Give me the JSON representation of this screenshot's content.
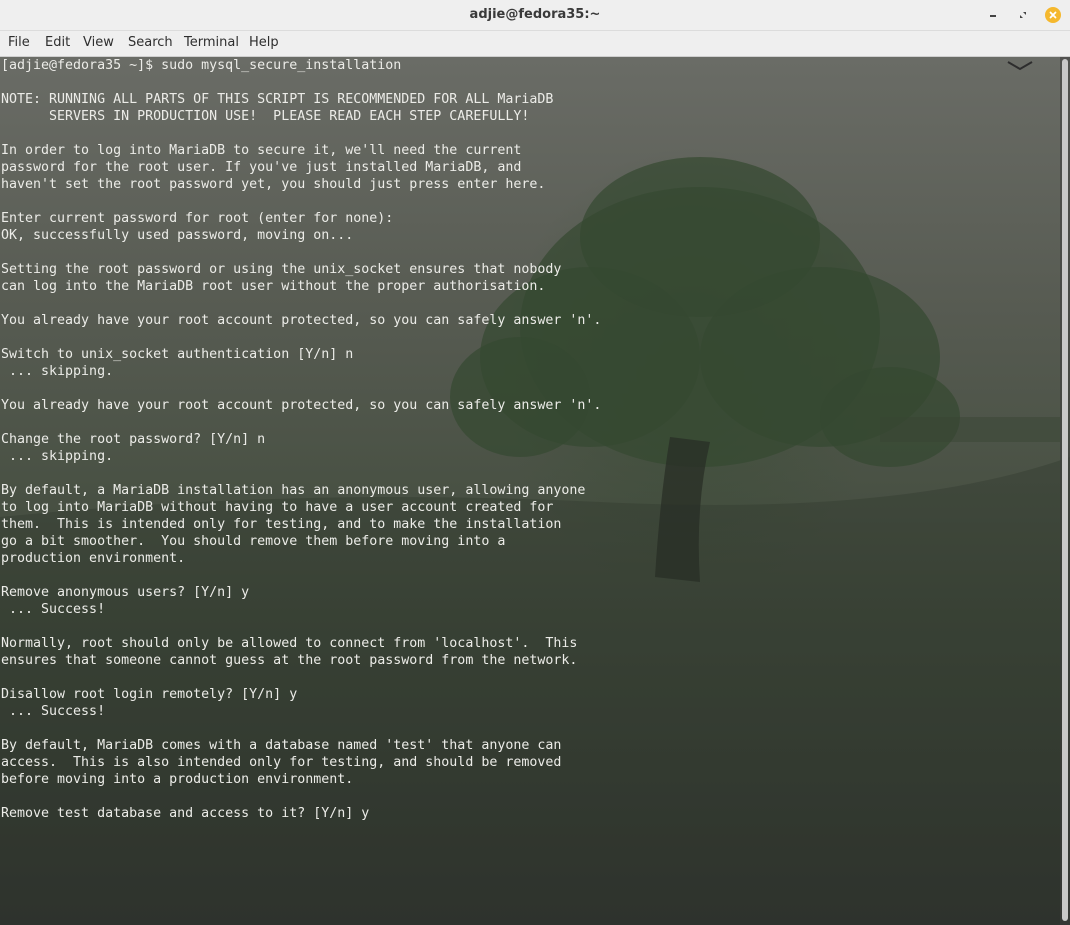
{
  "window": {
    "title": "adjie@fedora35:~"
  },
  "menu": [
    "File",
    "Edit",
    "View",
    "Search",
    "Terminal",
    "Help"
  ],
  "icons": {
    "minimize": "minimize-icon",
    "maximize": "maximize-icon",
    "close": "close-icon"
  },
  "colors": {
    "close_button": "#f5b82e",
    "terminal_text": "#ecece8",
    "titlebar": "#efefef"
  },
  "terminal": {
    "lines": [
      "[adjie@fedora35 ~]$ sudo mysql_secure_installation",
      "",
      "NOTE: RUNNING ALL PARTS OF THIS SCRIPT IS RECOMMENDED FOR ALL MariaDB",
      "      SERVERS IN PRODUCTION USE!  PLEASE READ EACH STEP CAREFULLY!",
      "",
      "In order to log into MariaDB to secure it, we'll need the current",
      "password for the root user. If you've just installed MariaDB, and",
      "haven't set the root password yet, you should just press enter here.",
      "",
      "Enter current password for root (enter for none):",
      "OK, successfully used password, moving on...",
      "",
      "Setting the root password or using the unix_socket ensures that nobody",
      "can log into the MariaDB root user without the proper authorisation.",
      "",
      "You already have your root account protected, so you can safely answer 'n'.",
      "",
      "Switch to unix_socket authentication [Y/n] n",
      " ... skipping.",
      "",
      "You already have your root account protected, so you can safely answer 'n'.",
      "",
      "Change the root password? [Y/n] n",
      " ... skipping.",
      "",
      "By default, a MariaDB installation has an anonymous user, allowing anyone",
      "to log into MariaDB without having to have a user account created for",
      "them.  This is intended only for testing, and to make the installation",
      "go a bit smoother.  You should remove them before moving into a",
      "production environment.",
      "",
      "Remove anonymous users? [Y/n] y",
      " ... Success!",
      "",
      "Normally, root should only be allowed to connect from 'localhost'.  This",
      "ensures that someone cannot guess at the root password from the network.",
      "",
      "Disallow root login remotely? [Y/n] y",
      " ... Success!",
      "",
      "By default, MariaDB comes with a database named 'test' that anyone can",
      "access.  This is also intended only for testing, and should be removed",
      "before moving into a production environment.",
      "",
      "Remove test database and access to it? [Y/n] y"
    ]
  }
}
